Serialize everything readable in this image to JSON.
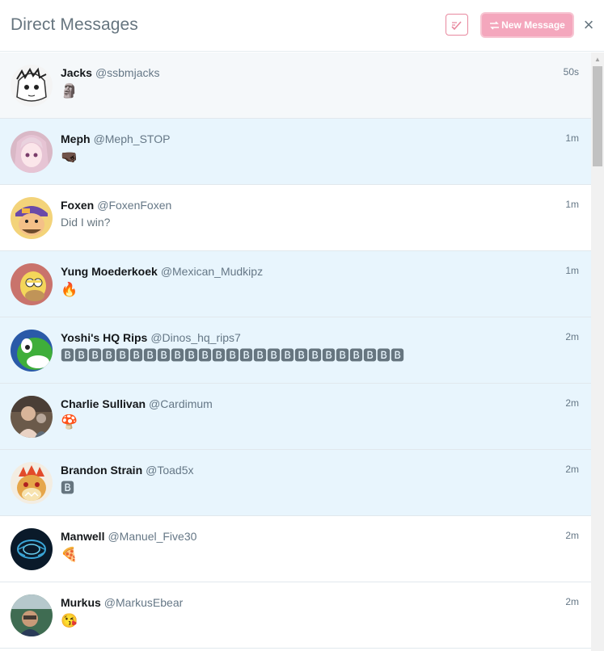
{
  "header": {
    "title": "Direct Messages",
    "new_message_label": "New Message",
    "close_symbol": "×",
    "mark_read_icon": "check-icon",
    "new_message_icon": "compose-icon"
  },
  "colors": {
    "accent_pink": "#f4a7bd",
    "unread_bg": "#e8f5fd",
    "unread_bg_alt": "#f5f8fa",
    "text_secondary": "#657786"
  },
  "conversations": [
    {
      "name": "Jacks",
      "handle": "@ssbmjacks",
      "time": "50s",
      "preview": "🗿",
      "avatar": "manga-sketch-avatar"
    },
    {
      "name": "Meph",
      "handle": "@Meph_STOP",
      "time": "1m",
      "preview": "🤜🏿",
      "avatar": "anime-pink-hair-avatar"
    },
    {
      "name": "Foxen",
      "handle": "@FoxenFoxen",
      "time": "1m",
      "preview": "Did I win?",
      "avatar": "cartoon-cap-avatar"
    },
    {
      "name": "Yung Moederkoek",
      "handle": "@Mexican_Mudkipz",
      "time": "1m",
      "preview": "🔥",
      "avatar": "homer-avatar"
    },
    {
      "name": "Yoshi's HQ Rips",
      "handle": "@Dinos_hq_rips7",
      "time": "2m",
      "preview": "🅱🅱🅱🅱🅱🅱🅱🅱🅱🅱🅱🅱🅱🅱🅱🅱🅱🅱🅱🅱🅱🅱🅱🅱🅱",
      "avatar": "yoshi-avatar"
    },
    {
      "name": "Charlie Sullivan",
      "handle": "@Cardimum",
      "time": "2m",
      "preview": "🍄",
      "avatar": "photo-person-avatar"
    },
    {
      "name": "Brandon Strain",
      "handle": "@Toad5x",
      "time": "2m",
      "preview": "🅱",
      "avatar": "bowser-avatar"
    },
    {
      "name": "Manwell",
      "handle": "@Manuel_Five30",
      "time": "2m",
      "preview": "🍕",
      "avatar": "blue-glow-avatar"
    },
    {
      "name": "Murkus",
      "handle": "@MarkusEbear",
      "time": "2m",
      "preview": "😘",
      "avatar": "photo-outdoor-avatar"
    }
  ]
}
